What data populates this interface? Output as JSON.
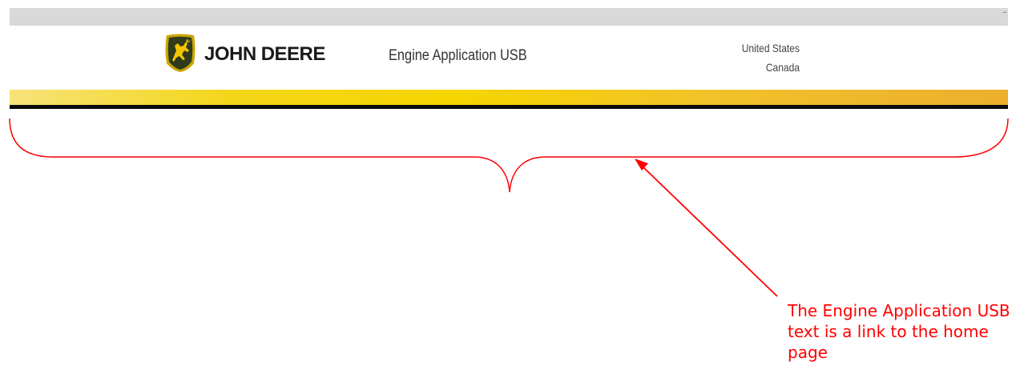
{
  "header": {
    "brand": {
      "first_word": "JOHN",
      "second_word": "DEERE"
    },
    "app_title": "Engine Application USB",
    "regions": [
      "United States",
      "Canada"
    ]
  },
  "annotation": {
    "callout_text": "The Engine Application USB text is a link to the home page",
    "color": "#ff0000"
  },
  "colors": {
    "gold_start": "#f6e37a",
    "gold_mid": "#f6d500",
    "gold_end": "#ecaf2e",
    "logo_green": "#2f3b1a",
    "logo_yellow": "#f2c500"
  },
  "icons": {
    "logo": "leaping-deer-logo-icon",
    "arrow": "annotation-arrow-icon",
    "brace": "curly-brace-icon"
  }
}
